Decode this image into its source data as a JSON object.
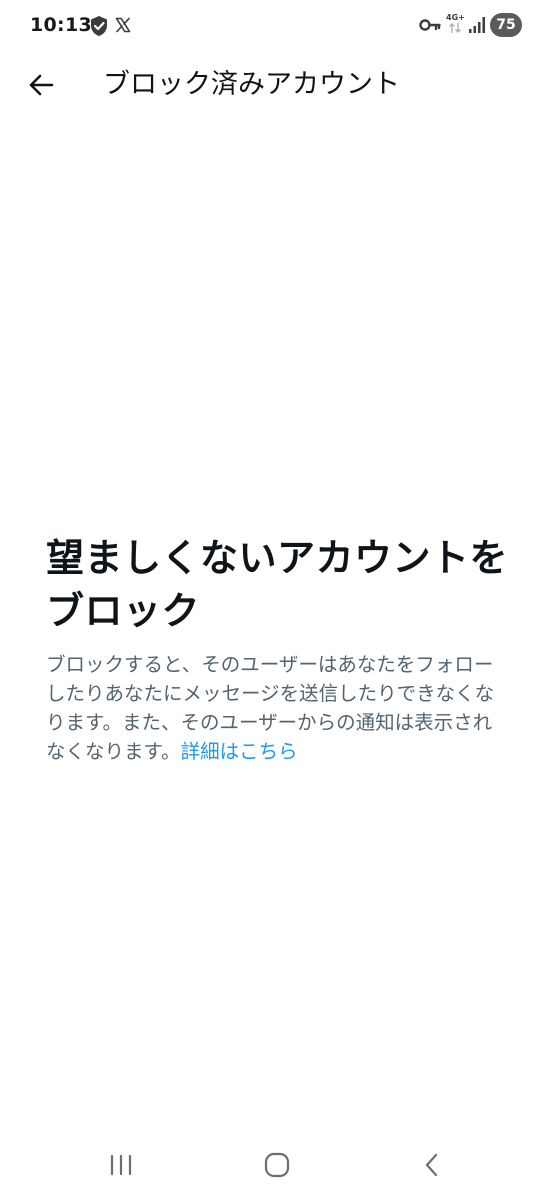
{
  "status_bar": {
    "time": "10:13",
    "network_label": "4G+",
    "battery_level": "75",
    "icons": [
      "shield-check-icon",
      "x-logo-icon",
      "key-icon",
      "network-icon",
      "signal-icon",
      "battery-icon"
    ]
  },
  "header": {
    "title": "ブロック済みアカウント",
    "back_icon": "arrow-left-icon"
  },
  "empty_state": {
    "title": "望ましくないアカウントをブロック",
    "description": "ブロックすると、そのユーザーはあなたをフォローしたりあなたにメッセージを送信したりできなくなります。また、そのユーザーからの通知は表示されなくなります。",
    "link_text": "詳細はこちら"
  },
  "nav_bar": {
    "icons": [
      "recents-icon",
      "home-icon",
      "back-icon"
    ]
  },
  "colors": {
    "text_primary": "#0f1419",
    "text_secondary": "#536471",
    "link": "#1d9bf0",
    "background": "#ffffff"
  }
}
